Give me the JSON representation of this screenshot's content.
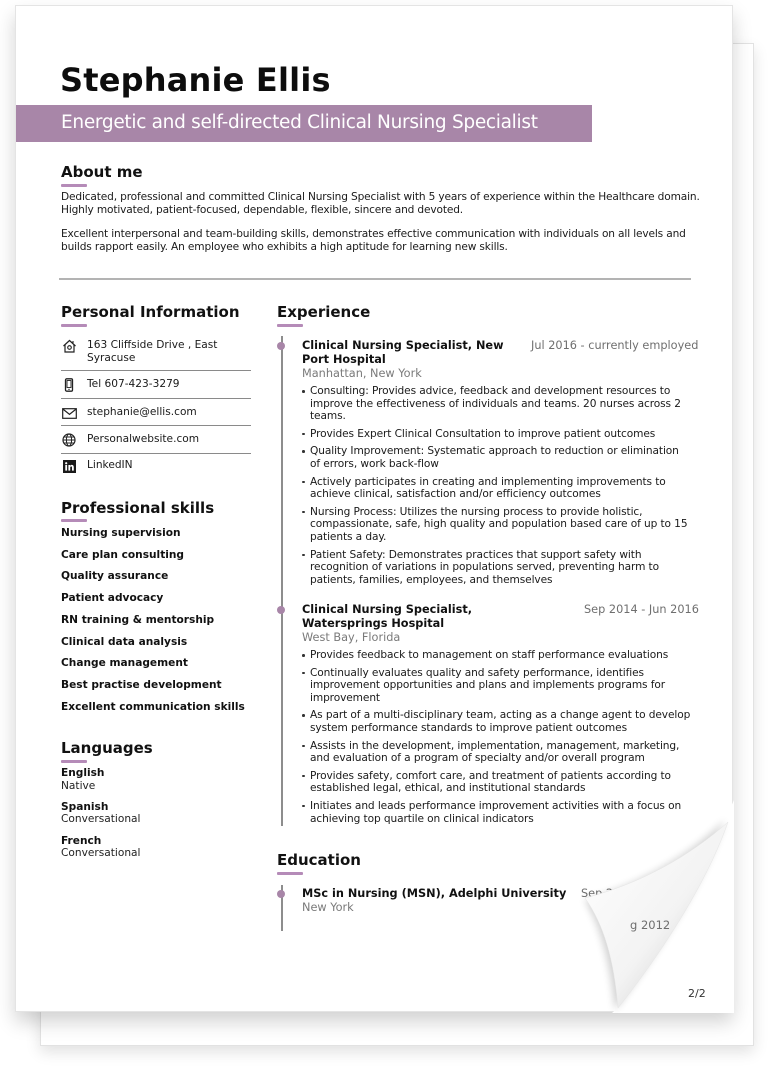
{
  "resume": {
    "name": "Stephanie Ellis",
    "tagline": "Energetic and self-directed Clinical Nursing Specialist",
    "accent_color": "#a886a8",
    "about": {
      "title": "About me",
      "paragraphs": [
        "Dedicated, professional and committed Clinical Nursing Specialist with 5 years of experience within the Healthcare domain. Highly motivated, patient-focused, dependable, flexible, sincere and devoted.",
        "Excellent interpersonal and team-building skills, demonstrates effective communication with individuals on all levels and builds rapport easily. An employee who exhibits a high aptitude for learning new skills."
      ]
    },
    "personal_info": {
      "title": "Personal Information",
      "items": [
        {
          "icon": "home-icon",
          "text": "163 Cliffside Drive , East Syracuse"
        },
        {
          "icon": "phone-icon",
          "text": "Tel 607-423-3279"
        },
        {
          "icon": "email-icon",
          "text": "stephanie@ellis.com"
        },
        {
          "icon": "globe-icon",
          "text": "Personalwebsite.com"
        },
        {
          "icon": "linkedin-icon",
          "text": "LinkedIN"
        }
      ]
    },
    "skills": {
      "title": "Professional skills",
      "items": [
        "Nursing supervision",
        "Care plan consulting",
        "Quality assurance",
        "Patient advocacy",
        "RN training & mentorship",
        "Clinical data analysis",
        "Change management",
        "Best practise development",
        "Excellent communication skills"
      ]
    },
    "languages": {
      "title": "Languages",
      "items": [
        {
          "name": "English",
          "level": "Native"
        },
        {
          "name": "Spanish",
          "level": "Conversational"
        },
        {
          "name": "French",
          "level": "Conversational"
        }
      ]
    },
    "experience": {
      "title": "Experience",
      "jobs": [
        {
          "title": "Clinical Nursing Specialist, New Port Hospital",
          "date": "Jul 2016 - currently employed",
          "location": "Manhattan, New York",
          "bullets": [
            "Consulting: Provides advice, feedback and development resources to improve the effectiveness of individuals and teams. 20 nurses across 2 teams.",
            "Provides Expert Clinical Consultation to improve patient outcomes",
            "Quality Improvement: Systematic approach to reduction or elimination of errors, work back-flow",
            "Actively participates in creating and implementing improvements to achieve clinical, satisfaction and/or efficiency outcomes",
            "Nursing Process: Utilizes the nursing process to provide holistic, compassionate, safe, high quality and population based care of up to 15 patients a day.",
            "Patient Safety: Demonstrates practices that support safety with recognition of variations in populations served, preventing harm to patients, families, employees, and themselves"
          ]
        },
        {
          "title": "Clinical Nursing Specialist, Watersprings Hospital",
          "date": "Sep 2014 - Jun 2016",
          "location": "West Bay, Florida",
          "bullets": [
            "Provides feedback to management on staff performance evaluations",
            "Continually evaluates quality and safety performance, identifies improvement opportunities and plans and implements programs for improvement",
            "As part of a multi-disciplinary team, acting as a change agent to develop system performance standards to improve patient outcomes",
            "Assists in the development, implementation, management, marketing, and evaluation of a program of specialty and/or overall program",
            "Provides safety, comfort care, and treatment of patients according to established legal, ethical, and institutional standards",
            "Initiates and leads performance improvement activities with a focus on achieving top quartile on clinical indicators"
          ]
        }
      ]
    },
    "education": {
      "title": "Education",
      "items": [
        {
          "title": "MSc in Nursing (MSN), Adelphi University",
          "date": "Sep 2012 - Aug 2014",
          "location": "New York"
        }
      ]
    }
  },
  "back_page": {
    "date_fragment": "g 2012",
    "page_number": "2/2"
  }
}
